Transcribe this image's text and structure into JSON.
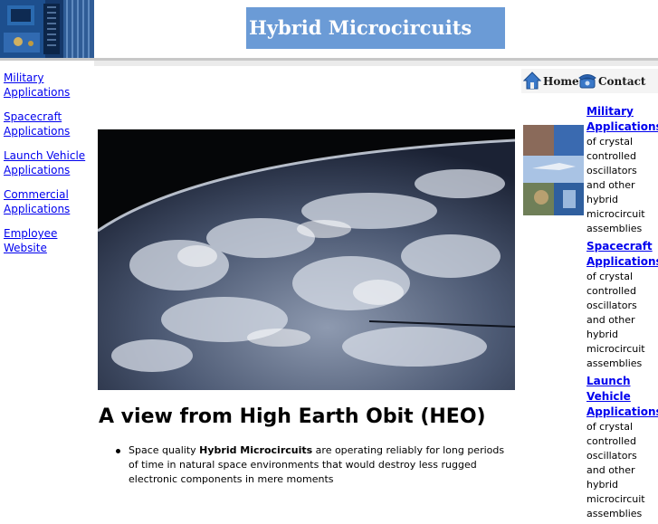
{
  "header": {
    "title": "Hybrid Microcircuits"
  },
  "left_nav": [
    {
      "label": "Military Applications"
    },
    {
      "label": "Spacecraft Applications"
    },
    {
      "label": "Launch Vehicle Applications"
    },
    {
      "label": "Commercial Applications"
    },
    {
      "label": "Employee Website"
    }
  ],
  "top_nav": {
    "home_label": "Home",
    "contact_label": "Contact",
    "home_icon": "house-icon",
    "contact_icon": "telephone-icon"
  },
  "main": {
    "headline": "A view from High Earth Obit (HEO)",
    "bullet1": {
      "prefix": "Space quality ",
      "bold": "Hybrid Microcircuits",
      "suffix": " are operating reliably for long periods of time in natural space environments that would destroy less rugged electronic components in mere moments"
    }
  },
  "right_col": [
    {
      "link": "Military Applications",
      "desc": "of crystal controlled oscillators and other hybrid microcircuit assemblies"
    },
    {
      "link": "Spacecraft Applications",
      "desc": "of crystal controlled oscillators and other hybrid microcircuit assemblies"
    },
    {
      "link": "Launch Vehicle Applications",
      "desc": "of crystal controlled oscillators and other hybrid microcircuit assemblies"
    }
  ],
  "colors": {
    "title_bg": "#6b9bd6",
    "link": "#0000ee"
  }
}
